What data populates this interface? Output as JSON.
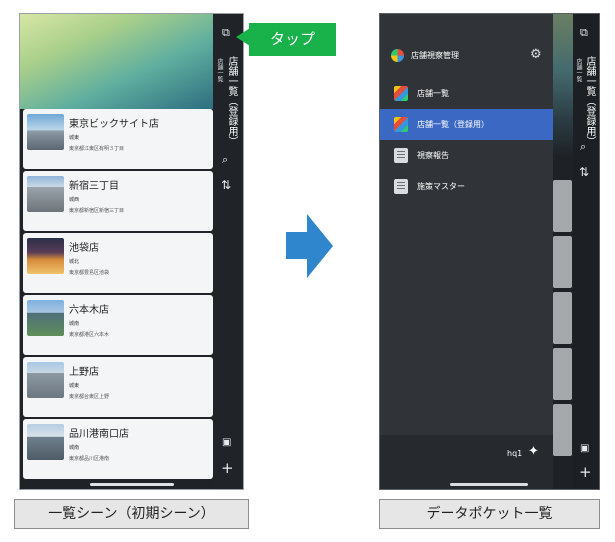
{
  "left_screen": {
    "side_title": "店舗一覧（登録用）",
    "side_subtitle": "店舗一覧",
    "side_icons": {
      "pocket": "pocket-icon",
      "search": "search-icon",
      "sort": "sort-icon",
      "photo": "photo-icon",
      "add": "plus-icon"
    },
    "shops": [
      {
        "name": "東京ビックサイト店",
        "area": "城東",
        "address": "東京都江東区有明３丁目"
      },
      {
        "name": "新宿三丁目",
        "area": "城西",
        "address": "東京都新宿区新宿三丁目"
      },
      {
        "name": "池袋店",
        "area": "城北",
        "address": "東京都豊島区池袋"
      },
      {
        "name": "六本木店",
        "area": "城南",
        "address": "東京都港区六本木"
      },
      {
        "name": "上野店",
        "area": "城東",
        "address": "東京都台東区上野"
      },
      {
        "name": "品川港南口店",
        "area": "城南",
        "address": "東京都品川区港南"
      }
    ]
  },
  "callout": {
    "label": "タップ"
  },
  "right_screen": {
    "drawer_title": "店舗視察管理",
    "menu": [
      {
        "label": "店舗一覧",
        "icon": "color",
        "selected": false
      },
      {
        "label": "店舗一覧（登録用）",
        "icon": "color",
        "selected": true
      },
      {
        "label": "視察報告",
        "icon": "doc",
        "selected": false
      },
      {
        "label": "施策マスター",
        "icon": "doc",
        "selected": false
      }
    ],
    "user": "hq1",
    "side_title": "店舗一覧（登録用）",
    "side_subtitle": "店舗一覧"
  },
  "captions": {
    "left": "一覧シーン（初期シーン）",
    "right": "データポケット一覧"
  },
  "colors": {
    "callout": "#18b14a",
    "arrow": "#2f86cc",
    "selected_menu": "#3b68c3"
  }
}
